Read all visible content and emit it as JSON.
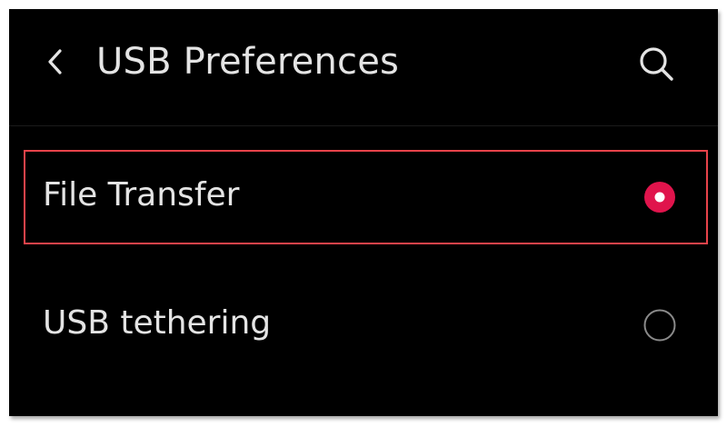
{
  "header": {
    "title": "USB Preferences",
    "back_icon": "chevron-left-icon",
    "search_icon": "search-icon"
  },
  "options": [
    {
      "label": "File Transfer",
      "selected": true
    },
    {
      "label": "USB tethering",
      "selected": false
    }
  ],
  "colors": {
    "background": "#000000",
    "text": "#e4e4e4",
    "accent": "#e0144c",
    "highlight_border": "#e8434a",
    "radio_unselected": "#8a8a8a"
  }
}
